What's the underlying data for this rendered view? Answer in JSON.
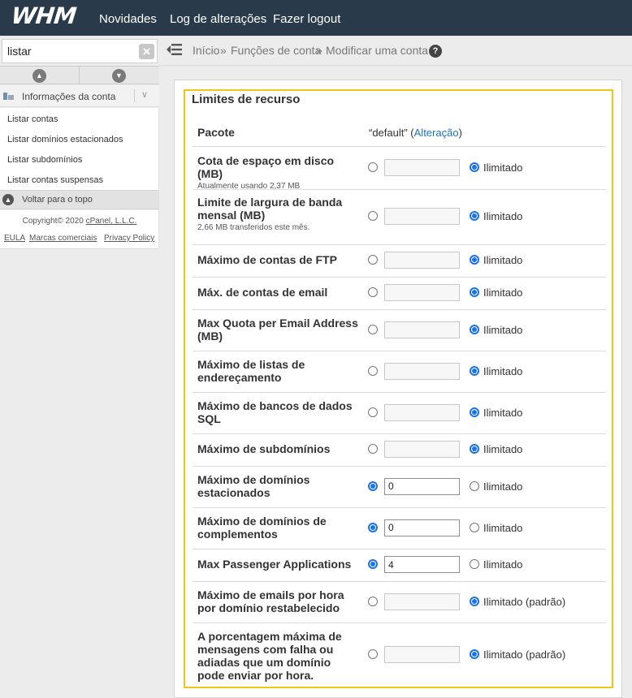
{
  "app": {
    "logo": "WHM"
  },
  "topnav": [
    "Novidades",
    "Log de alterações",
    "Fazer logout"
  ],
  "sidebar": {
    "search_value": "listar",
    "clear_icon": "close-icon",
    "category": "Informações da conta",
    "items": [
      "Listar contas",
      "Listar domínios estacionados",
      "Listar subdomínios",
      "Listar contas suspensas"
    ],
    "back_to_top": "Voltar para o topo",
    "copyright_prefix": "Copyright© 2020 ",
    "copyright_link": "cPanel, L.L.C.",
    "footer_links": [
      "EULA",
      "Marcas comerciais",
      "Privacy Policy"
    ]
  },
  "breadcrumb": {
    "home": "Início",
    "separator": "»",
    "section": "Funções de conta",
    "current": "Modificar uma conta",
    "help": "?"
  },
  "panel": {
    "title": "Limites de recurso",
    "package_label": "Pacote",
    "package_value": "“default” (",
    "package_change": "Alteração",
    "package_close": ")",
    "rows": [
      {
        "label": "Cota de espaço em disco (MB)",
        "sub": "Atualmente usando 2,37 MB",
        "value": "",
        "option": "Ilimitado",
        "custom_selected": false
      },
      {
        "label": "Limite de largura de banda mensal (MB)",
        "sub": "2,66 MB transferidos este mês.",
        "value": "",
        "option": "Ilimitado",
        "custom_selected": false
      },
      {
        "label": "Máximo de contas de FTP",
        "sub": "",
        "value": "",
        "option": "Ilimitado",
        "custom_selected": false
      },
      {
        "label": "Máx. de contas de email",
        "sub": "",
        "value": "",
        "option": "Ilimitado",
        "custom_selected": false
      },
      {
        "label": "Max Quota per Email Address (MB)",
        "sub": "",
        "value": "",
        "option": "Ilimitado",
        "custom_selected": false
      },
      {
        "label": "Máximo de listas de endereçamento",
        "sub": "",
        "value": "",
        "option": "Ilimitado",
        "custom_selected": false
      },
      {
        "label": "Máximo de bancos de dados SQL",
        "sub": "",
        "value": "",
        "option": "Ilimitado",
        "custom_selected": false
      },
      {
        "label": "Máximo de subdomínios",
        "sub": "",
        "value": "",
        "option": "Ilimitado",
        "custom_selected": false
      },
      {
        "label": "Máximo de domínios estacionados",
        "sub": "",
        "value": "0",
        "option": "Ilimitado",
        "custom_selected": true
      },
      {
        "label": "Máximo de domínios de complementos",
        "sub": "",
        "value": "0",
        "option": "Ilimitado",
        "custom_selected": true
      },
      {
        "label": "Max Passenger Applications",
        "sub": "",
        "value": "4",
        "option": "Ilimitado",
        "custom_selected": true
      },
      {
        "label": "Máximo de emails por hora por domínio restabelecido",
        "sub": "",
        "value": "",
        "option": "Ilimitado (padrão)",
        "custom_selected": false
      },
      {
        "label": "A porcentagem máxima de mensagens com falha ou adiadas que um domínio pode enviar por hora.",
        "sub": "",
        "value": "",
        "option": "Ilimitado (padrão)",
        "custom_selected": false
      }
    ]
  }
}
